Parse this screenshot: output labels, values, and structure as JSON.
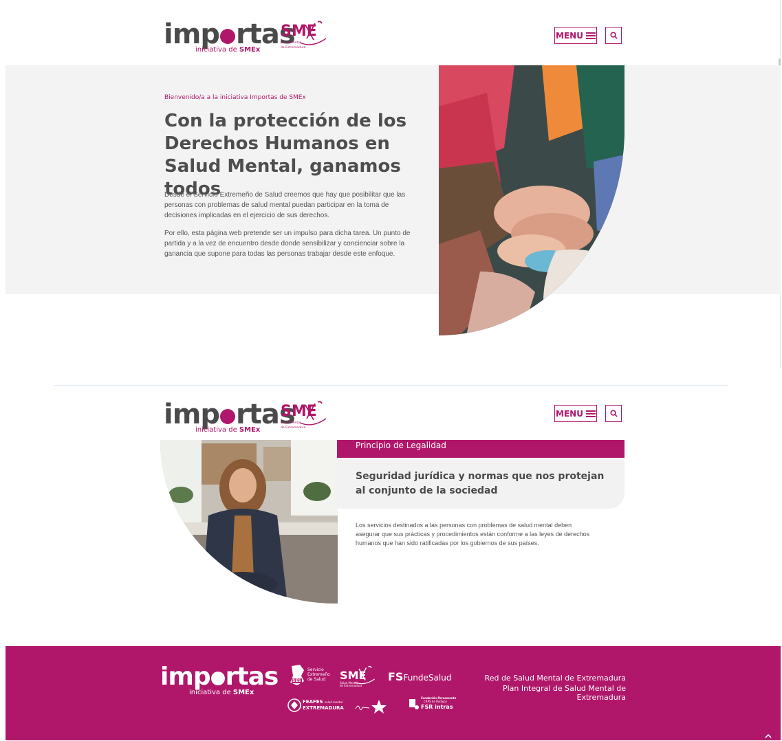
{
  "brand": {
    "logo_word_a": "imp",
    "logo_word_b": "rtas",
    "logo_sub_prefix": "iniciativa de ",
    "logo_sub_bold": "SMEx",
    "smex_word": "SME",
    "smex_tagline_1": "Salud Mental",
    "smex_tagline_2": "de Extremadura"
  },
  "header": {
    "menu_label": "MENU",
    "menu_icon": "hamburger-icon",
    "search_icon": "search-icon"
  },
  "hero": {
    "welcome": "Bienvenido/a a la iniciativa Importas de SMEx",
    "title": "Con la protección de los Derechos Humanos en Salud Mental, ganamos todos",
    "paragraph_1": "Desde el Servicio Extremeño de Salud creemos que hay que posibilitar que las personas con problemas de salud mental puedan participar en la toma de decisiones implicadas en el ejercicio de sus derechos.",
    "paragraph_2": "Por ello, esta página web pretende ser un impulso para dicha tarea. Un punto de partida y a la vez de encuentro desde donde sensibilizar y concienciar sobre la ganancia que supone para todas las personas trabajar desde este enfoque."
  },
  "principle": {
    "label": "Principio de Legalidad",
    "heading": "Seguridad jurídica y normas que nos protejan al conjunto de la sociedad",
    "body": "Los servicios destinados a las personas con problemas de salud mental deben asegurar que sus prácticas y procedimientos están conforme a las leyes de derechos humanos que han sido ratificadas por los gobiernos de sus países."
  },
  "footer": {
    "partners": {
      "ses_1": "Servicio",
      "ses_2": "Extremeño",
      "ses_3": "de Salud",
      "ses_badge": "SES",
      "smex": "SME",
      "fundesalud_fs": "FS",
      "fundesalud": "FundeSalud",
      "feafes_1": "FEAFES",
      "feafes_sub": "salud mental",
      "feafes_2": "EXTREMADURA",
      "fundacion_1": "Fundación Persamento",
      "fundacion_2": "CRPS de Badajoz",
      "fsr": "FSR intras"
    },
    "links": [
      "Red de Salud Mental de Extremadura",
      "Plan Integral de Salud Mental de Extremadura"
    ],
    "top_icon": "chevron-up-icon"
  },
  "colors": {
    "brand": "#b0176a",
    "text": "#4e4e4e",
    "hero_bg": "#f3f3f3"
  }
}
